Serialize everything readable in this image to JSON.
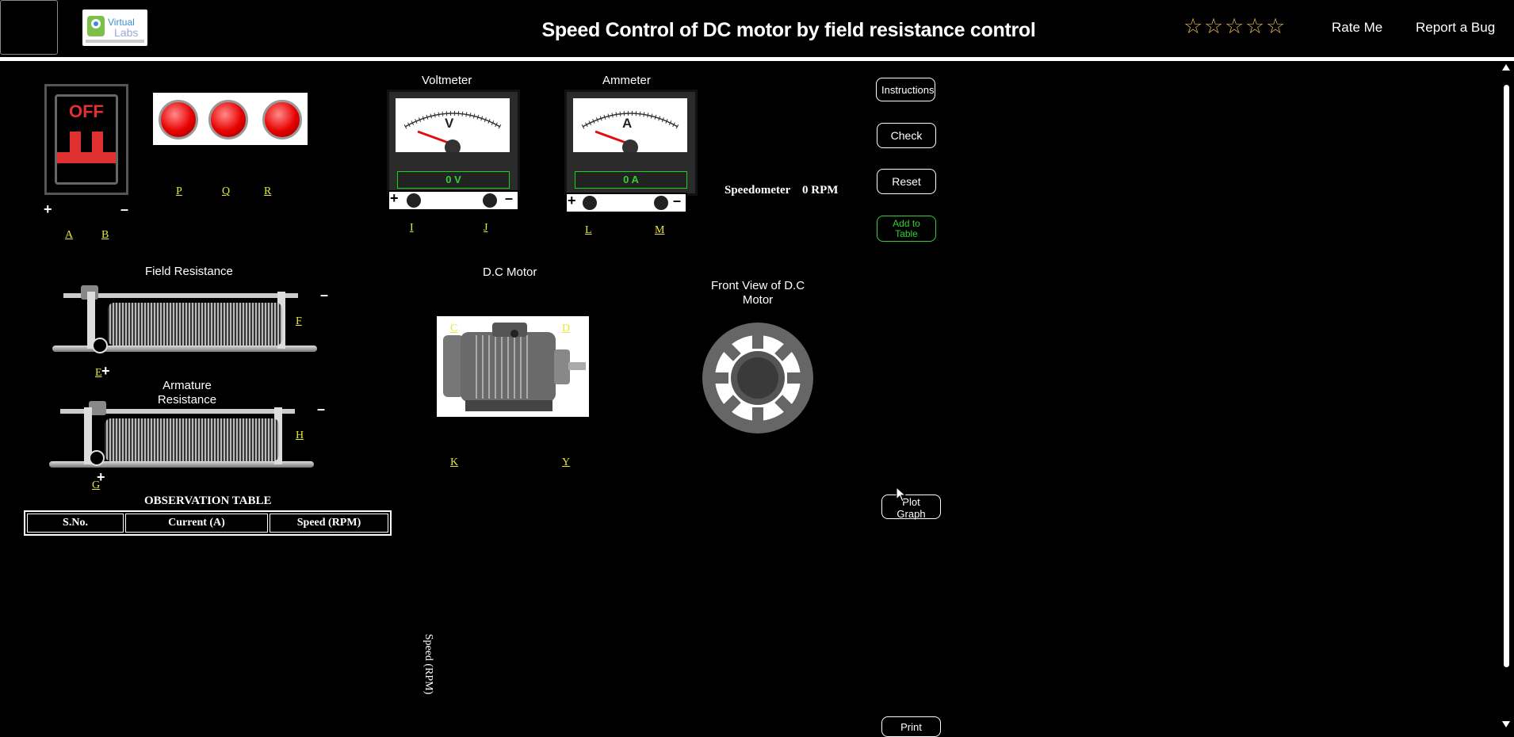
{
  "header": {
    "title": "Speed Control of DC motor by field resistance control",
    "stars": [
      "☆",
      "☆",
      "☆",
      "☆",
      "☆"
    ],
    "rate_me": "Rate Me",
    "report_bug": "Report a Bug",
    "logo_text": "Virtual Labs"
  },
  "supply": {
    "switch_state": "OFF",
    "plus": "+",
    "minus": "–",
    "terminal_a": "A",
    "terminal_b": "B"
  },
  "lamps": {
    "terminal_p": "P",
    "terminal_q": "Q",
    "terminal_r": "R"
  },
  "voltmeter": {
    "title": "Voltmeter",
    "symbol": "V",
    "reading": "0 V",
    "terminal_i": "I",
    "terminal_j": "J"
  },
  "ammeter": {
    "title": "Ammeter",
    "symbol": "A",
    "reading": "0 A",
    "terminal_l": "L",
    "terminal_m": "M"
  },
  "speedometer": {
    "label": "Speedometer",
    "value": "0 RPM"
  },
  "buttons": {
    "instructions": "Instructions",
    "check": "Check",
    "reset": "Reset",
    "add_to_table": "Add to Table",
    "plot_graph": "Plot Graph",
    "print": "Print"
  },
  "field_resistance": {
    "title": "Field Resistance",
    "terminal_e": "E",
    "terminal_f": "F",
    "plus": "+",
    "minus": "–"
  },
  "armature_resistance": {
    "title": "Armature Resistance",
    "terminal_g": "G",
    "terminal_h": "H",
    "plus": "+",
    "minus": "–"
  },
  "motor": {
    "title": "D.C Motor",
    "terminal_c": "C",
    "terminal_d": "D",
    "terminal_k": "K",
    "terminal_y": "Y"
  },
  "front_view": {
    "title": "Front View of D.C Motor"
  },
  "observation_table": {
    "title": "OBSERVATION TABLE",
    "columns": [
      "S.No.",
      "Current (A)",
      "Speed (RPM)"
    ]
  },
  "graph": {
    "ylabel": "Speed (RPM)"
  },
  "colors": {
    "terminal_label": "#e7e73a",
    "reading_green": "#33d033",
    "switch_red": "#e03030",
    "star_gold": "#d8b25a"
  }
}
